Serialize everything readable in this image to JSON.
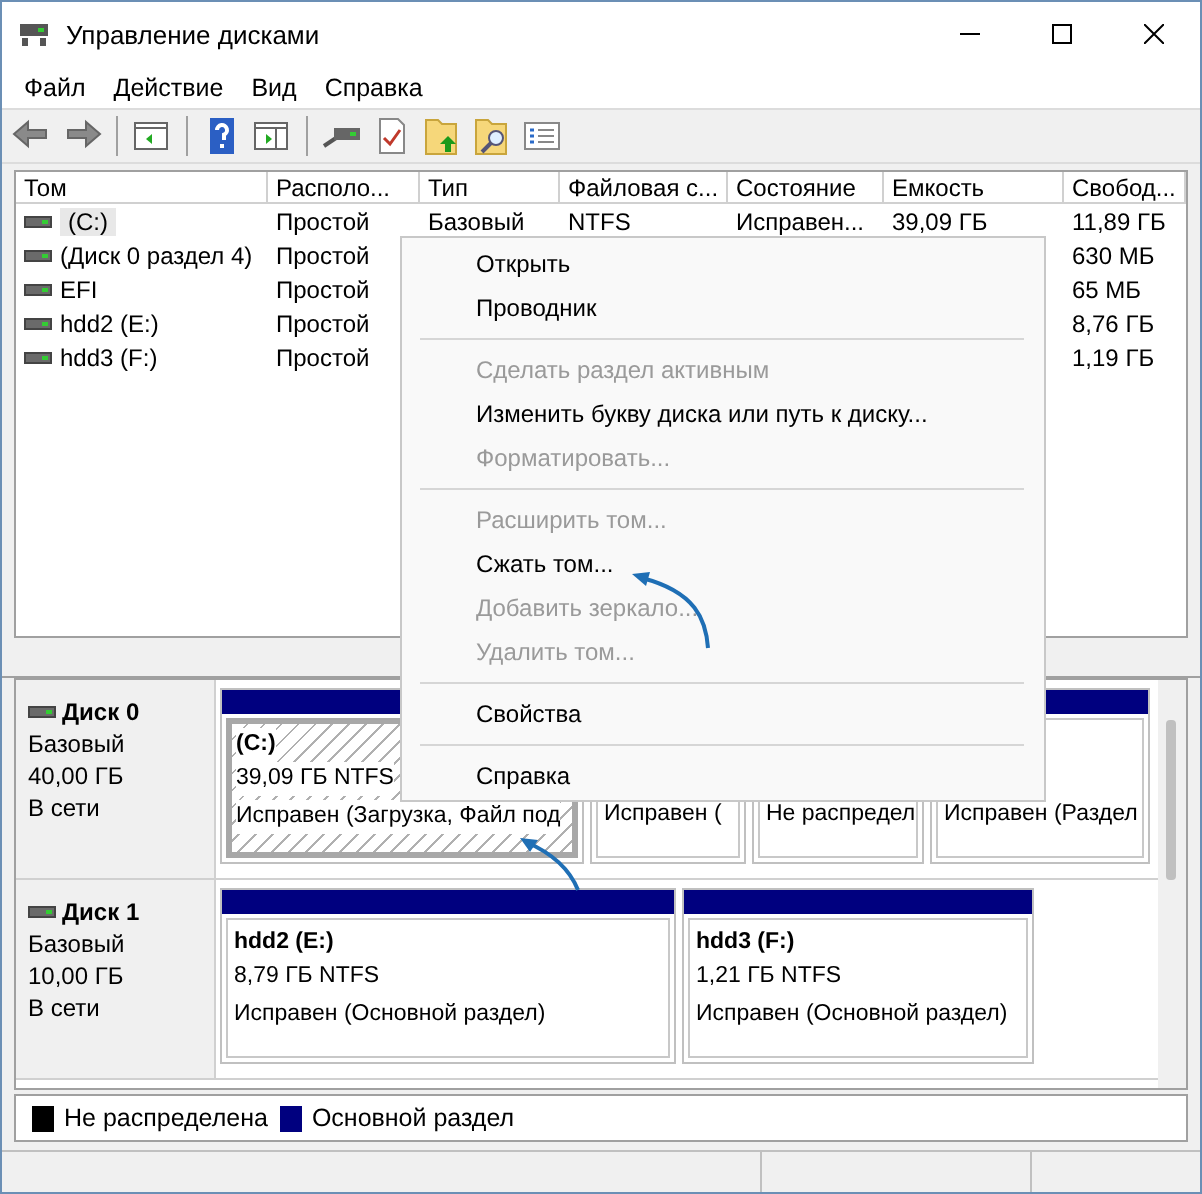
{
  "window": {
    "title": "Управление дисками"
  },
  "menu_bar": [
    "Файл",
    "Действие",
    "Вид",
    "Справка"
  ],
  "toolbar": [
    {
      "kind": "back"
    },
    {
      "kind": "forward"
    },
    {
      "kind": "sep"
    },
    {
      "kind": "tree"
    },
    {
      "kind": "sep"
    },
    {
      "kind": "help"
    },
    {
      "kind": "pane"
    },
    {
      "kind": "sep"
    },
    {
      "kind": "connect"
    },
    {
      "kind": "check"
    },
    {
      "kind": "folder-up"
    },
    {
      "kind": "folder-search"
    },
    {
      "kind": "list"
    }
  ],
  "table": {
    "columns": [
      "Том",
      "Располо...",
      "Тип",
      "Файловая с...",
      "Состояние",
      "Емкость",
      "Свобод..."
    ],
    "rows": [
      {
        "selected": true,
        "cells": [
          "(C:)",
          "Простой",
          "Базовый",
          "NTFS",
          "Исправен...",
          "39,09 ГБ",
          "11,89 ГБ"
        ]
      },
      {
        "selected": false,
        "cells": [
          "(Диск 0 раздел 4)",
          "Простой",
          null,
          null,
          null,
          null,
          "630 МБ"
        ]
      },
      {
        "selected": false,
        "cells": [
          "EFI",
          "Простой",
          null,
          null,
          null,
          null,
          "65 МБ"
        ]
      },
      {
        "selected": false,
        "cells": [
          "hdd2 (E:)",
          "Простой",
          null,
          null,
          null,
          null,
          "8,76 ГБ"
        ]
      },
      {
        "selected": false,
        "cells": [
          "hdd3 (F:)",
          "Простой",
          null,
          null,
          null,
          null,
          "1,19 ГБ"
        ]
      }
    ]
  },
  "disks": [
    {
      "name": "Диск 0",
      "type": "Базовый",
      "size": "40,00 ГБ",
      "status": "В сети",
      "partitions": [
        {
          "kind": "primary",
          "selected": true,
          "name": "(C:)",
          "size": "39,09 ГБ NTFS",
          "status": "Исправен (Загрузка, Файл под"
        },
        {
          "kind": "primary",
          "selected": false,
          "status": "Исправен ("
        },
        {
          "kind": "unallocated",
          "selected": false,
          "status": "Не распредел"
        },
        {
          "kind": "primary",
          "selected": false,
          "status": "Исправен (Раздел"
        }
      ]
    },
    {
      "name": "Диск 1",
      "type": "Базовый",
      "size": "10,00 ГБ",
      "status": "В сети",
      "partitions": [
        {
          "kind": "primary",
          "selected": false,
          "name": "hdd2  (E:)",
          "size": "8,79 ГБ NTFS",
          "status": "Исправен (Основной раздел)"
        },
        {
          "kind": "primary",
          "selected": false,
          "name": "hdd3  (F:)",
          "size": "1,21 ГБ NTFS",
          "status": "Исправен (Основной раздел)"
        }
      ]
    }
  ],
  "legend": [
    {
      "kind": "unallocated",
      "label": "Не распределена"
    },
    {
      "kind": "primary",
      "label": "Основной раздел"
    }
  ],
  "context_menu": [
    {
      "kind": "item",
      "label": "Открыть",
      "disabled": false
    },
    {
      "kind": "item",
      "label": "Проводник",
      "disabled": false
    },
    {
      "kind": "separator"
    },
    {
      "kind": "item",
      "label": "Сделать раздел активным",
      "disabled": true
    },
    {
      "kind": "item",
      "label": "Изменить букву диска или путь к диску...",
      "disabled": false
    },
    {
      "kind": "item",
      "label": "Форматировать...",
      "disabled": true
    },
    {
      "kind": "separator"
    },
    {
      "kind": "item",
      "label": "Расширить том...",
      "disabled": true
    },
    {
      "kind": "item",
      "label": "Сжать том...",
      "disabled": false
    },
    {
      "kind": "item",
      "label": "Добавить зеркало...",
      "disabled": true
    },
    {
      "kind": "item",
      "label": "Удалить том...",
      "disabled": true
    },
    {
      "kind": "separator"
    },
    {
      "kind": "item",
      "label": "Свойства",
      "disabled": false
    },
    {
      "kind": "separator"
    },
    {
      "kind": "item",
      "label": "Справка",
      "disabled": false
    }
  ]
}
